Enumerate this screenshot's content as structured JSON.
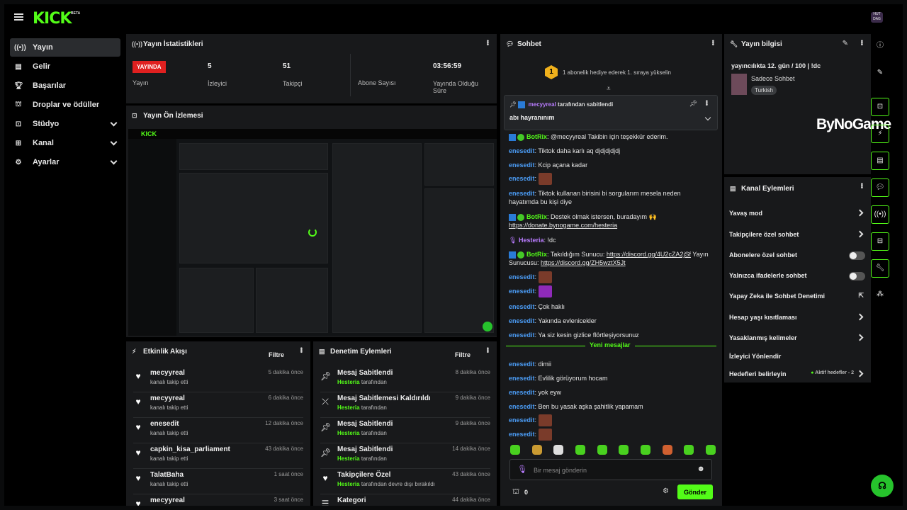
{
  "brand": {
    "logo": "KICK",
    "beta": "BETA",
    "avatar_text": "HUT DAG"
  },
  "sidebar": {
    "items": [
      {
        "label": "Yayın",
        "icon": "broadcast-icon"
      },
      {
        "label": "Gelir",
        "icon": "revenue-icon"
      },
      {
        "label": "Başarılar",
        "icon": "trophy-icon"
      },
      {
        "label": "Droplar ve ödüller",
        "icon": "gift-icon"
      },
      {
        "label": "Stüdyo",
        "icon": "studio-icon"
      },
      {
        "label": "Kanal",
        "icon": "channel-icon"
      },
      {
        "label": "Ayarlar",
        "icon": "gear-icon"
      }
    ]
  },
  "stats": {
    "title": "Yayın İstatistikleri",
    "live_badge": "YAYINDA",
    "live_label": "Yayın",
    "viewers_value": "5",
    "viewers_label": "İzleyici",
    "followers_value": "51",
    "followers_label": "Takipçi",
    "subs_label": "Abone Sayısı",
    "duration_value": "03:56:59",
    "duration_label_1": "Yayında Olduğu",
    "duration_label_2": "Süre"
  },
  "preview": {
    "title": "Yayın Ön İzlemesi",
    "logo": "KICK"
  },
  "activity": {
    "title": "Etkinlik Akışı",
    "filter": "Filtre",
    "items": [
      {
        "name": "mecyyreal",
        "sub": "kanalı takip etti",
        "time": "5 dakika önce"
      },
      {
        "name": "mecyyreal",
        "sub": "kanalı takip etti",
        "time": "6 dakika önce"
      },
      {
        "name": "enesedit",
        "sub": "kanalı takip etti",
        "time": "12 dakika önce"
      },
      {
        "name": "capkin_kisa_parliament",
        "sub": "kanalı takip etti",
        "time": "43 dakika önce"
      },
      {
        "name": "TalatBaha",
        "sub": "kanalı takip etti",
        "time": "1 saat önce"
      },
      {
        "name": "mecyyreal",
        "sub": "",
        "time": "3 saat önce"
      }
    ]
  },
  "moderation": {
    "title": "Denetim Eylemleri",
    "filter": "Filtre",
    "items": [
      {
        "name": "Mesaj Sabitlendi",
        "user": "Hesteria",
        "sub": "tarafından",
        "time": "8 dakika önce"
      },
      {
        "name": "Mesaj Sabitlemesi Kaldırıldı",
        "user": "Hesteria",
        "sub": "tarafından",
        "time": "9 dakika önce"
      },
      {
        "name": "Mesaj Sabitlendi",
        "user": "Hesteria",
        "sub": "tarafından",
        "time": "9 dakika önce"
      },
      {
        "name": "Mesaj Sabitlendi",
        "user": "Hesteria",
        "sub": "tarafından",
        "time": "14 dakika önce"
      },
      {
        "name": "Takipçilere Özel",
        "user": "Hesteria",
        "sub": "tarafından devre dışı bırakıldı",
        "time": "43 dakika önce"
      },
      {
        "name": "Kategori",
        "user": "",
        "sub": "",
        "time": "44 dakika önce"
      }
    ]
  },
  "chat": {
    "title": "Sohbet",
    "gift_count": "1",
    "gift_text": "1 abonelik hediye ederek 1. sıraya yükselin",
    "pinned_by_user": "mecyyreal",
    "pinned_by_text": "tarafından sabitlendi",
    "pinned_message": "abı hayranınım",
    "new_messages": "Yeni mesajlar",
    "input_placeholder": "Bir mesaj gönderin",
    "points": "0",
    "send": "Gönder",
    "m1_user": "BotRix",
    "m1_text": ": @mecyyreal Takibin için teşekkür ederim.",
    "m2_user": "enesedit",
    "m2_text": ": Tiktok daha karlı aq djdjdjdjdj",
    "m3_user": "enesedit",
    "m3_text": ": Kcip açana kadar",
    "m4_user": "enesedit",
    "m4_text": ":",
    "m5_user": "enesedit",
    "m5_text": ": Tiktok kullanan birisini bi sorgularım mesela neden hayatımda bu kişi diye",
    "m6_user": "BotRix",
    "m6_text": ": Destek olmak istersen, buradayım 🙌 ",
    "m6_link": "https://donate.bynogame.com/hesteria",
    "m7_user": "Hesteria",
    "m7_text": ": !dc",
    "m8_user": "BotRix",
    "m8_text": ": Takıldığım Sunucu: ",
    "m8_link1": "https://discord.gg/4U2cZA2jSf",
    "m8_text2": " Yayın Sunucusu: ",
    "m8_link2": "https://discord.gg/ZH5wztX5Jt",
    "m9_user": "enesedit",
    "m9_text": ":",
    "m10_user": "enesedit",
    "m10_text": ":",
    "m11_user": "enesedit",
    "m11_text": ": Çok haklı",
    "m12_user": "enesedit",
    "m12_text": ": Yakında evlenicekler",
    "m13_user": "enesedit",
    "m13_text": ": Ya siz kesin gizlice flörtleşiyorsunuz",
    "n1_user": "enesedit",
    "n1_text": ": dimii",
    "n2_user": "enesedit",
    "n2_text": ": Evlilik görüyorum hocam",
    "n3_user": "enesedit",
    "n3_text": ": yok eyw",
    "n4_user": "enesedit",
    "n4_text": ": Ben bu yasak aşka şahitlik yapamam",
    "n5_user": "enesedit",
    "n5_text": ":",
    "n6_user": "enesedit",
    "n6_text": ":"
  },
  "stream_info": {
    "title": "Yayın bilgisi",
    "stream_title": "yayıncılıkta 12. gün / 100 | !dc",
    "category": "Sadece Sohbet",
    "language": "Turkish",
    "overlay_brand": "ByNoGame"
  },
  "channel_actions": {
    "title": "Kanal Eylemleri",
    "items": [
      {
        "label": "Yavaş mod",
        "control": "chevron"
      },
      {
        "label": "Takipçilere özel sohbet",
        "control": "chevron"
      },
      {
        "label": "Abonelere özel sohbet",
        "control": "toggle"
      },
      {
        "label": "Yalnızca ifadelerle sohbet",
        "control": "toggle"
      },
      {
        "label": "Yapay Zeka ile Sohbet Denetimi",
        "control": "external"
      },
      {
        "label": "Hesap yaşı kısıtlaması",
        "control": "chevron"
      },
      {
        "label": "Yasaklanmış kelimeler",
        "control": "chevron"
      },
      {
        "label": "İzleyici Yönlendir",
        "control": "none"
      },
      {
        "label": "Hedefleri belirleyin",
        "control": "chevron",
        "extra": "Aktif hedefler - 2"
      }
    ]
  },
  "colors": {
    "accent": "#53fc18",
    "live": "#e02020",
    "username": "#4b9cf5",
    "panel": "#18191b"
  }
}
